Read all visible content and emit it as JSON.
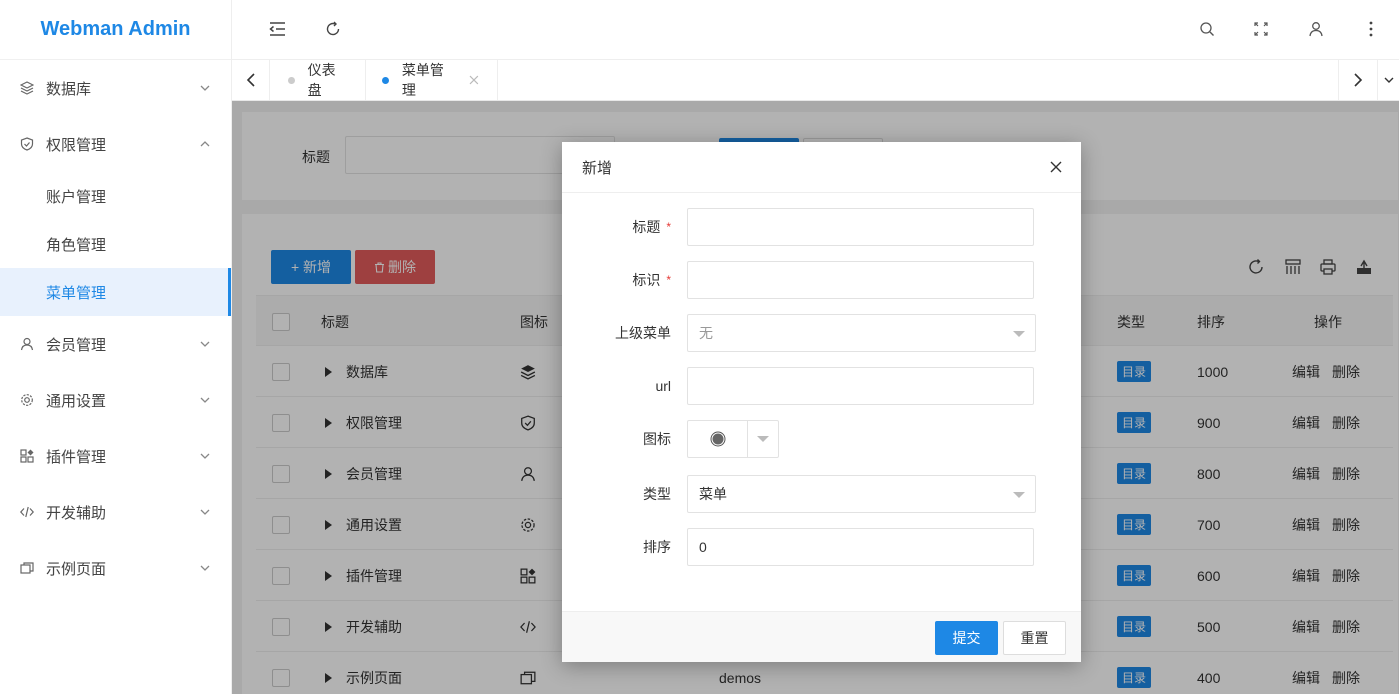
{
  "app": {
    "title": "Webman Admin"
  },
  "sidebar": {
    "items": [
      {
        "label": "数据库",
        "icon": "layers-icon",
        "expanded": false
      },
      {
        "label": "权限管理",
        "icon": "shield-icon",
        "expanded": true,
        "children": [
          {
            "label": "账户管理",
            "active": false
          },
          {
            "label": "角色管理",
            "active": false
          },
          {
            "label": "菜单管理",
            "active": true
          }
        ]
      },
      {
        "label": "会员管理",
        "icon": "user-icon",
        "expanded": false
      },
      {
        "label": "通用设置",
        "icon": "gear-icon",
        "expanded": false
      },
      {
        "label": "插件管理",
        "icon": "apps-icon",
        "expanded": false
      },
      {
        "label": "开发辅助",
        "icon": "code-icon",
        "expanded": false
      },
      {
        "label": "示例页面",
        "icon": "pages-icon",
        "expanded": false
      }
    ]
  },
  "tabs": [
    {
      "label": "仪表盘",
      "active": false
    },
    {
      "label": "菜单管理",
      "active": true,
      "closable": true
    }
  ],
  "search": {
    "title_label": "标题"
  },
  "toolbar": {
    "add_label": "+ 新增",
    "delete_label": "删除"
  },
  "table": {
    "headers": {
      "title": "标题",
      "icon": "图标",
      "type": "类型",
      "sort": "排序",
      "actions": "操作"
    },
    "rows": [
      {
        "title": "数据库",
        "icon": "layers-icon",
        "key": "",
        "type": "目录",
        "sort": "1000"
      },
      {
        "title": "权限管理",
        "icon": "shield-icon",
        "key": "",
        "type": "目录",
        "sort": "900"
      },
      {
        "title": "会员管理",
        "icon": "user-icon",
        "key": "",
        "type": "目录",
        "sort": "800"
      },
      {
        "title": "通用设置",
        "icon": "gear-icon",
        "key": "",
        "type": "目录",
        "sort": "700"
      },
      {
        "title": "插件管理",
        "icon": "apps-icon",
        "key": "",
        "type": "目录",
        "sort": "600"
      },
      {
        "title": "开发辅助",
        "icon": "code-icon",
        "key": "",
        "type": "目录",
        "sort": "500"
      },
      {
        "title": "示例页面",
        "icon": "pages-icon",
        "key": "demos",
        "type": "目录",
        "sort": "400"
      }
    ],
    "edit_label": "编辑",
    "delete_label": "删除"
  },
  "dialog": {
    "title": "新增",
    "fields": {
      "title": {
        "label": "标题",
        "required": true,
        "value": ""
      },
      "key": {
        "label": "标识",
        "required": true,
        "value": ""
      },
      "parent": {
        "label": "上级菜单",
        "value": "无"
      },
      "url": {
        "label": "url",
        "value": ""
      },
      "icon": {
        "label": "图标"
      },
      "type": {
        "label": "类型",
        "value": "菜单"
      },
      "sort": {
        "label": "排序",
        "value": "0"
      }
    },
    "submit_label": "提交",
    "reset_label": "重置"
  },
  "colors": {
    "primary": "#1e88e5",
    "danger": "#e25c5c"
  }
}
